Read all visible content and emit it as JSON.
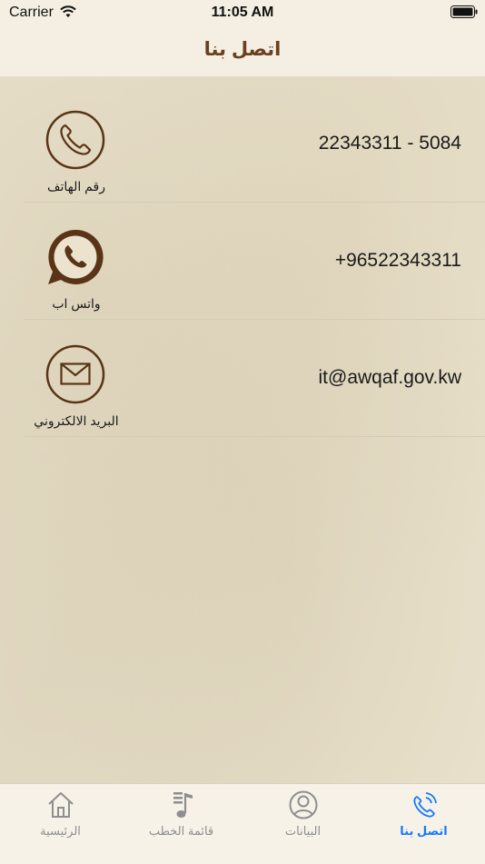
{
  "status": {
    "carrier": "Carrier",
    "time": "11:05 AM"
  },
  "navbar": {
    "title": "اتصل بنا"
  },
  "contacts": [
    {
      "value": "22343311 - 5084",
      "label": "رقم الهاتف",
      "icon": "phone-icon"
    },
    {
      "value": "+96522343311",
      "label": "واتس اب",
      "icon": "whatsapp-icon"
    },
    {
      "value": "it@awqaf.gov.kw",
      "label": "البريد الالكتروني",
      "icon": "envelope-icon"
    }
  ],
  "tabs": [
    {
      "label": "الرئيسية",
      "icon": "home-icon",
      "active": false
    },
    {
      "label": "قائمة الخطب",
      "icon": "music-list-icon",
      "active": false
    },
    {
      "label": "البيانات",
      "icon": "user-circle-icon",
      "active": false
    },
    {
      "label": "اتصل بنا",
      "icon": "phone-call-icon",
      "active": true
    }
  ],
  "colors": {
    "brown": "#5a3417",
    "title": "#6b3f1f",
    "active_tab": "#1479ff",
    "inactive_tab": "#8e8e8e"
  }
}
